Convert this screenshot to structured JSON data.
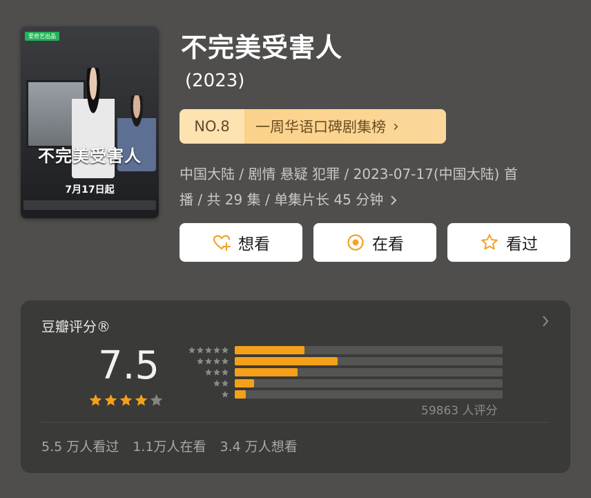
{
  "poster": {
    "badge": "爱奇艺出品",
    "title": "不完美受害人",
    "date": "7月17日起"
  },
  "title": "不完美受害人",
  "year": "(2023)",
  "rank": {
    "number": "NO.8",
    "list_name": "一周华语口碑剧集榜",
    "chevron": "›"
  },
  "meta": {
    "line1": "中国大陆 / 剧情 悬疑 犯罪 / 2023-07-17(中国大陆) 首",
    "line2": "播 / 共 29 集 / 单集片长 45 分钟",
    "more_icon": "chevron-right-icon"
  },
  "actions": [
    {
      "label": "想看",
      "icon": "heart-plus-icon"
    },
    {
      "label": "在看",
      "icon": "circle-dot-icon"
    },
    {
      "label": "看过",
      "icon": "star-outline-icon"
    }
  ],
  "rating": {
    "source": "豆瓣评分®",
    "score": "7.5",
    "stars": 4,
    "distribution": [
      {
        "stars": 5,
        "percent": 26.0
      },
      {
        "stars": 4,
        "percent": 38.5
      },
      {
        "stars": 3,
        "percent": 23.5
      },
      {
        "stars": 2,
        "percent": 7.2
      },
      {
        "stars": 1,
        "percent": 4.0
      }
    ],
    "count": "59863 人评分",
    "stats": [
      "5.5 万人看过",
      "1.1万人在看",
      "3.4 万人想看"
    ]
  },
  "colors": {
    "accent": "#f5a019",
    "background": "#4f4e4c",
    "card": "#3a3a39"
  }
}
